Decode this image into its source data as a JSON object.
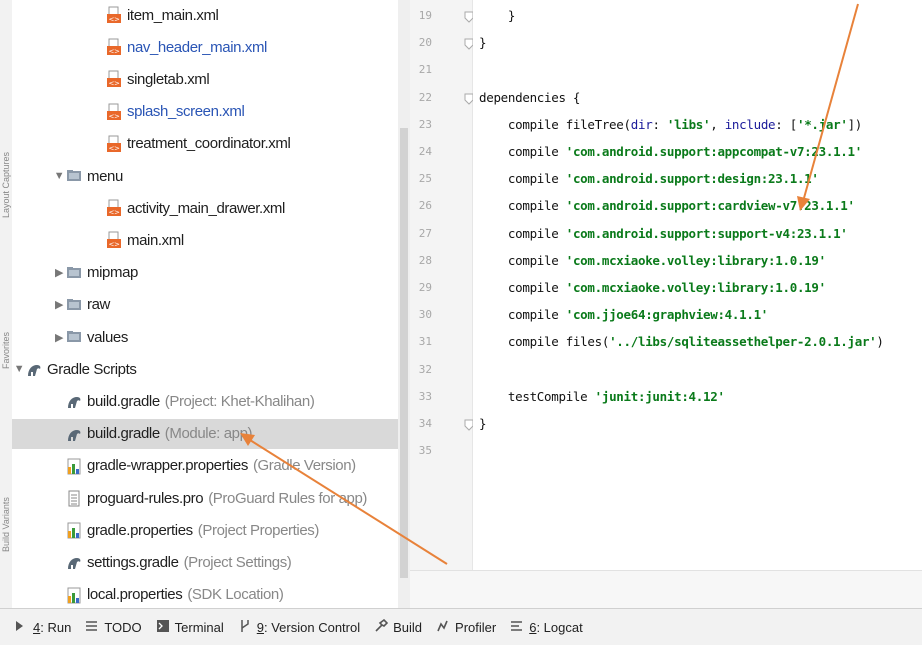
{
  "side_tabs": [
    "Layout Captures",
    "Favorites",
    "Build Variants"
  ],
  "tree": [
    {
      "label": "item_main.xml",
      "hint": "",
      "icon": "xml-file-icon",
      "color": "",
      "arrow": ""
    },
    {
      "label": "nav_header_main.xml",
      "hint": "",
      "icon": "xml-file-icon",
      "color": "blue",
      "arrow": ""
    },
    {
      "label": "singletab.xml",
      "hint": "",
      "icon": "xml-file-icon",
      "color": "",
      "arrow": ""
    },
    {
      "label": "splash_screen.xml",
      "hint": "",
      "icon": "xml-file-icon",
      "color": "blue",
      "arrow": ""
    },
    {
      "label": "treatment_coordinator.xml",
      "hint": "",
      "icon": "xml-file-icon",
      "color": "",
      "arrow": ""
    },
    {
      "label": "menu",
      "hint": "",
      "icon": "folder-icon",
      "color": "",
      "arrow": "▼"
    },
    {
      "label": "activity_main_drawer.xml",
      "hint": "",
      "icon": "xml-file-icon",
      "color": "",
      "arrow": ""
    },
    {
      "label": "main.xml",
      "hint": "",
      "icon": "xml-file-icon",
      "color": "",
      "arrow": ""
    },
    {
      "label": "mipmap",
      "hint": "",
      "icon": "folder-icon",
      "color": "",
      "arrow": "▶"
    },
    {
      "label": "raw",
      "hint": "",
      "icon": "folder-icon",
      "color": "",
      "arrow": "▶"
    },
    {
      "label": "values",
      "hint": "",
      "icon": "folder-icon",
      "color": "",
      "arrow": "▶"
    },
    {
      "label": "Gradle Scripts",
      "hint": "",
      "icon": "gradle-icon",
      "color": "",
      "arrow": "▼"
    },
    {
      "label": "build.gradle",
      "hint": "(Project: Khet-Khalihan)",
      "icon": "gradle-icon",
      "color": "",
      "arrow": ""
    },
    {
      "label": "build.gradle",
      "hint": "(Module: app)",
      "icon": "gradle-icon",
      "color": "",
      "arrow": "",
      "selected": true
    },
    {
      "label": "gradle-wrapper.properties",
      "hint": "(Gradle Version)",
      "icon": "properties-icon",
      "color": "",
      "arrow": ""
    },
    {
      "label": "proguard-rules.pro",
      "hint": "(ProGuard Rules for app)",
      "icon": "text-file-icon",
      "color": "",
      "arrow": ""
    },
    {
      "label": "gradle.properties",
      "hint": "(Project Properties)",
      "icon": "properties-icon",
      "color": "",
      "arrow": ""
    },
    {
      "label": "settings.gradle",
      "hint": "(Project Settings)",
      "icon": "gradle-icon",
      "color": "",
      "arrow": ""
    },
    {
      "label": "local.properties",
      "hint": "(SDK Location)",
      "icon": "properties-icon",
      "color": "",
      "arrow": ""
    }
  ],
  "code_lines": [
    {
      "n": "19",
      "code": [
        [
          "    }",
          ""
        ]
      ]
    },
    {
      "n": "20",
      "code": [
        [
          "}",
          ""
        ]
      ]
    },
    {
      "n": "21",
      "code": [
        [
          "",
          ""
        ]
      ]
    },
    {
      "n": "22",
      "code": [
        [
          "dependencies {",
          ""
        ]
      ]
    },
    {
      "n": "23",
      "code": [
        [
          "    compile fileTree(",
          ""
        ],
        [
          "dir",
          "k"
        ],
        [
          ": ",
          ""
        ],
        [
          "'libs'",
          "s"
        ],
        [
          ", ",
          ""
        ],
        [
          "include",
          "k"
        ],
        [
          ": [",
          ""
        ],
        [
          "'*.jar'",
          "s"
        ],
        [
          "])",
          ""
        ]
      ]
    },
    {
      "n": "24",
      "code": [
        [
          "    compile ",
          ""
        ],
        [
          "'com.android.support:appcompat-v7:23.1.1'",
          "s"
        ]
      ]
    },
    {
      "n": "25",
      "code": [
        [
          "    compile ",
          ""
        ],
        [
          "'com.android.support:design:23.1.1'",
          "s"
        ]
      ]
    },
    {
      "n": "26",
      "code": [
        [
          "    compile ",
          ""
        ],
        [
          "'com.android.support:cardview-v7:23.1.1'",
          "s"
        ]
      ]
    },
    {
      "n": "27",
      "code": [
        [
          "    compile ",
          ""
        ],
        [
          "'com.android.support:support-v4:23.1.1'",
          "s"
        ]
      ]
    },
    {
      "n": "28",
      "code": [
        [
          "    compile ",
          ""
        ],
        [
          "'com.mcxiaoke.volley:library:1.0.19'",
          "s"
        ]
      ]
    },
    {
      "n": "29",
      "code": [
        [
          "    compile ",
          ""
        ],
        [
          "'com.mcxiaoke.volley:library:1.0.19'",
          "s"
        ]
      ]
    },
    {
      "n": "30",
      "code": [
        [
          "    compile ",
          ""
        ],
        [
          "'com.jjoe64:graphview:4.1.1'",
          "s"
        ]
      ]
    },
    {
      "n": "31",
      "code": [
        [
          "    compile files(",
          ""
        ],
        [
          "'../libs/sqliteassethelper-2.0.1.jar'",
          "s"
        ],
        [
          ")",
          ""
        ]
      ]
    },
    {
      "n": "32",
      "code": [
        [
          "",
          ""
        ]
      ]
    },
    {
      "n": "33",
      "code": [
        [
          "    testCompile ",
          ""
        ],
        [
          "'junit:junit:4.12'",
          "s"
        ]
      ]
    },
    {
      "n": "34",
      "code": [
        [
          "}",
          ""
        ]
      ]
    },
    {
      "n": "35",
      "code": [
        [
          "",
          ""
        ]
      ]
    }
  ],
  "toolbar": [
    {
      "icon": "run-icon",
      "key": "4",
      "label": ": Run"
    },
    {
      "icon": "todo-icon",
      "key": "",
      "label": "TODO"
    },
    {
      "icon": "terminal-icon",
      "key": "",
      "label": "Terminal"
    },
    {
      "icon": "version-control-icon",
      "key": "9",
      "label": ": Version Control"
    },
    {
      "icon": "build-icon",
      "key": "",
      "label": "Build"
    },
    {
      "icon": "profiler-icon",
      "key": "",
      "label": "Profiler"
    },
    {
      "icon": "logcat-icon",
      "key": "6",
      "label": ": Logcat"
    }
  ],
  "colors": {
    "annotation_arrow": "#e8823a",
    "string": "#0a7a1a",
    "selection": "#d9d9d9"
  }
}
